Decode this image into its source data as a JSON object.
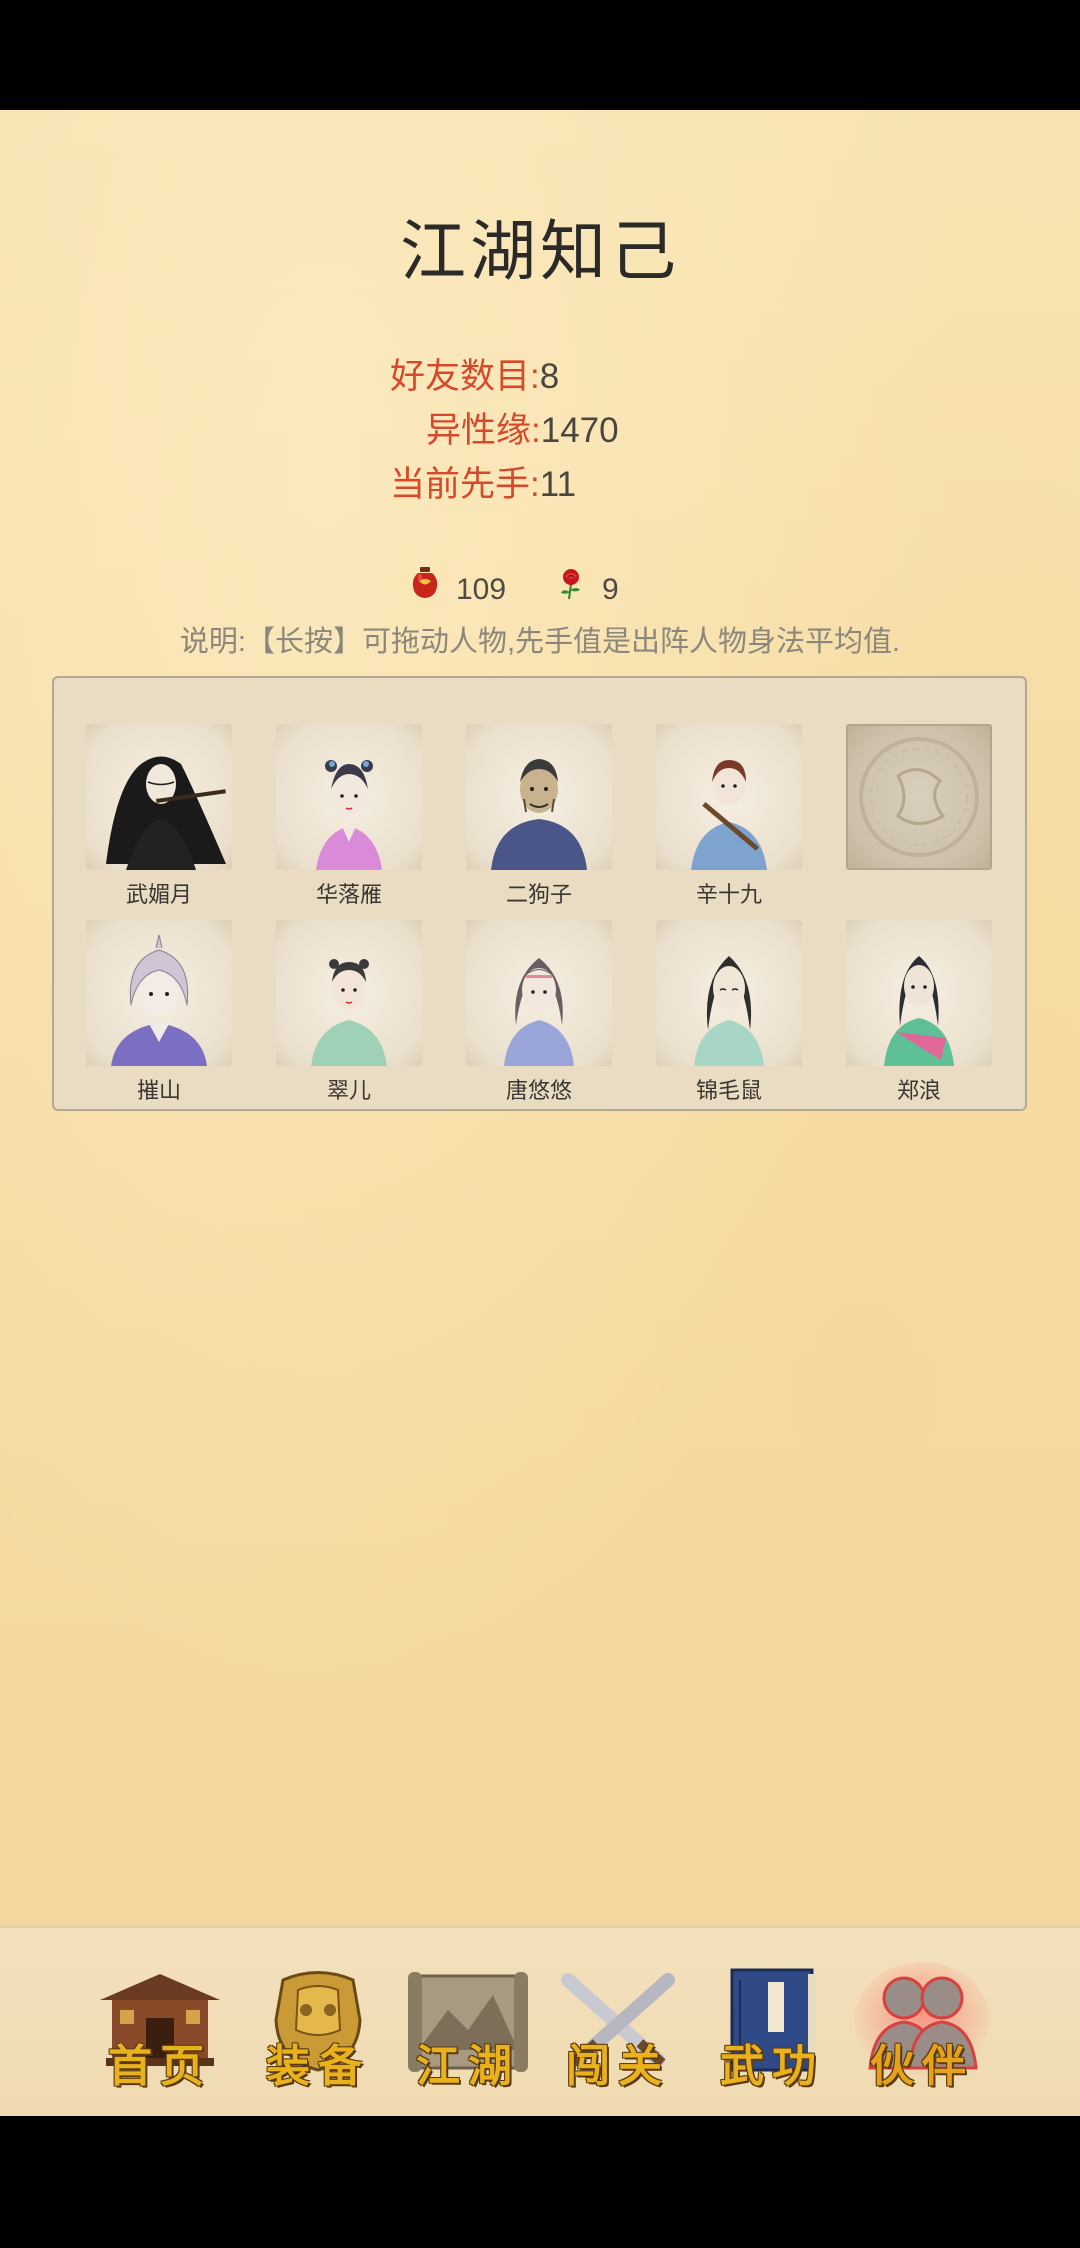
{
  "page": {
    "title": "江湖知己"
  },
  "stats": {
    "friends_label": "好友数目:",
    "friends_value": "8",
    "affinity_label": "异性缘:",
    "affinity_value": "1470",
    "initiative_label": "当前先手:",
    "initiative_value": "11"
  },
  "currencies": {
    "wine_icon": "wine-jar-icon",
    "wine_value": "109",
    "rose_icon": "rose-icon",
    "rose_value": "9"
  },
  "hint": "说明:【长按】可拖动人物,先手值是出阵人物身法平均值.",
  "characters": [
    {
      "name": "武媚月"
    },
    {
      "name": "华落雁"
    },
    {
      "name": "二狗子"
    },
    {
      "name": "辛十九"
    },
    {
      "name": ""
    },
    {
      "name": "摧山"
    },
    {
      "name": "翠儿"
    },
    {
      "name": "唐悠悠"
    },
    {
      "name": "锦毛鼠"
    },
    {
      "name": "郑浪"
    }
  ],
  "nav": {
    "home": "首页",
    "equip": "装备",
    "jianghu": "江湖",
    "stage": "闯关",
    "kungfu": "武功",
    "partner": "伙伴",
    "active": "partner"
  },
  "colors": {
    "accent_red": "#d5492c",
    "nav_gold": "#e9b11c"
  }
}
